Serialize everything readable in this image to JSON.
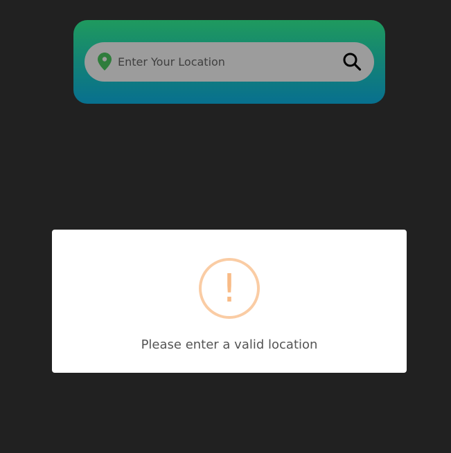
{
  "search": {
    "placeholder": "Enter Your Location",
    "value": ""
  },
  "icons": {
    "location": "location-pin-icon",
    "search": "search-icon",
    "warning": "warning-exclamation-icon"
  },
  "alert": {
    "symbol": "!",
    "message": "Please enter a valid location"
  },
  "colors": {
    "background": "#212121",
    "card_gradient_top": "#1f9a5e",
    "card_gradient_bottom": "#08708f",
    "search_bar": "#9c9c9c",
    "pin": "#2f7d3c",
    "warning": "#f8bb86",
    "alert_text": "#545454"
  }
}
